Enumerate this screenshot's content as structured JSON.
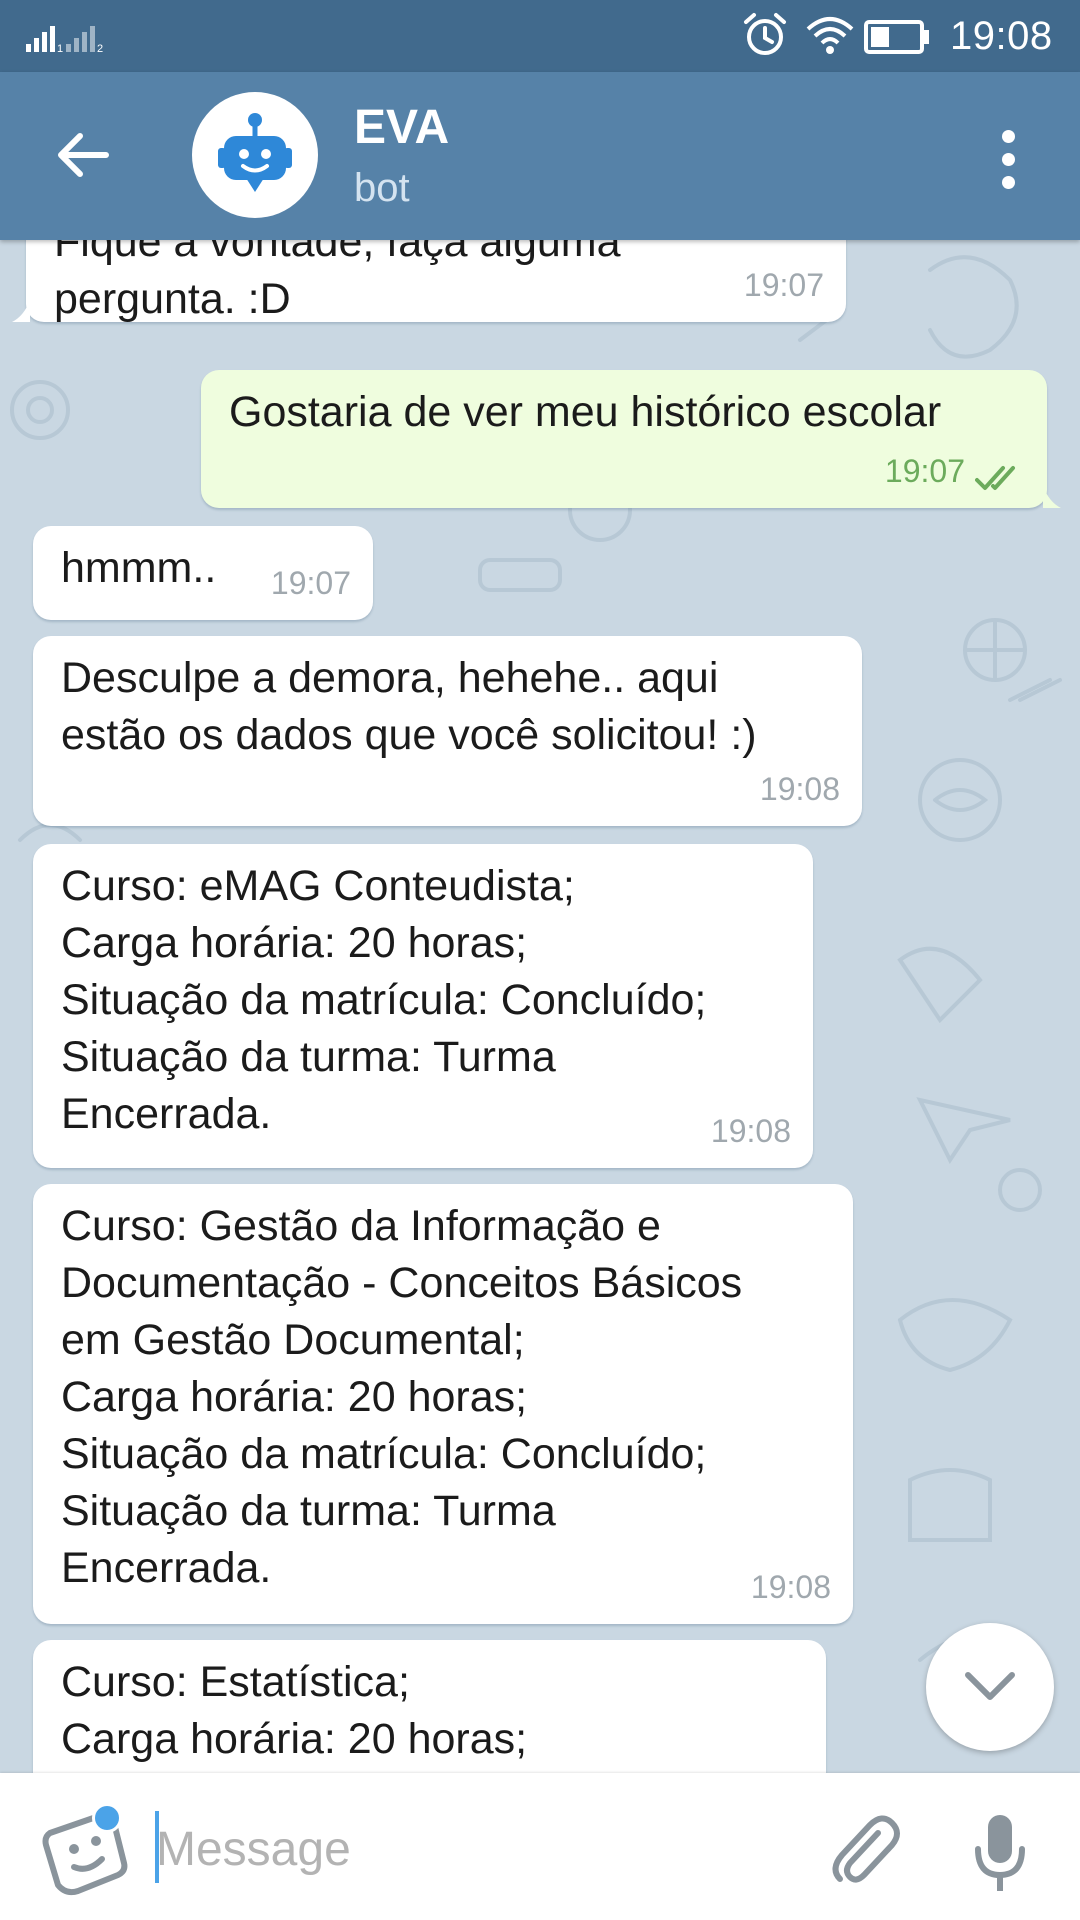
{
  "status_bar": {
    "time": "19:08",
    "sim1_label": "1",
    "sim2_label": "2"
  },
  "header": {
    "title": "EVA",
    "subtitle": "bot"
  },
  "messages": [
    {
      "direction": "in",
      "text": "Fique à vontade, faça alguma\npergunta. :D",
      "time": "19:07"
    },
    {
      "direction": "out",
      "text": "Gostaria de ver meu histórico escolar",
      "time": "19:07",
      "status": "read"
    },
    {
      "direction": "in",
      "text": "hmmm..",
      "time": "19:07"
    },
    {
      "direction": "in",
      "text": "Desculpe a demora, hehehe.. aqui\nestão os dados que você solicitou! :)",
      "time": "19:08"
    },
    {
      "direction": "in",
      "text": "Curso: eMAG Conteudista;\nCarga horária: 20 horas;\nSituação da matrícula: Concluído;\nSituação da turma: Turma\nEncerrada.",
      "time": "19:08"
    },
    {
      "direction": "in",
      "text": "Curso: Gestão da Informação e\nDocumentação - Conceitos Básicos\nem Gestão Documental;\nCarga horária: 20 horas;\nSituação da matrícula: Concluído;\nSituação da turma: Turma\nEncerrada.",
      "time": "19:08"
    },
    {
      "direction": "in",
      "text": "Curso: Estatística;\nCarga horária: 20 horas;",
      "time": ""
    }
  ],
  "input": {
    "placeholder": "Message",
    "value": ""
  },
  "icons": {
    "back": "arrow-left-icon",
    "menu": "more-vertical-icon",
    "avatar": "robot-icon",
    "sticker": "sticker-icon",
    "attach": "paperclip-icon",
    "mic": "microphone-icon",
    "scroll": "chevron-down-icon"
  },
  "colors": {
    "status_bar": "#416a8d",
    "header": "#5682a8",
    "chat_bg": "#c9d7e2",
    "bubble_in": "#ffffff",
    "bubble_out": "#effdde",
    "out_time": "#6cab5c",
    "accent": "#4ba3e8"
  }
}
